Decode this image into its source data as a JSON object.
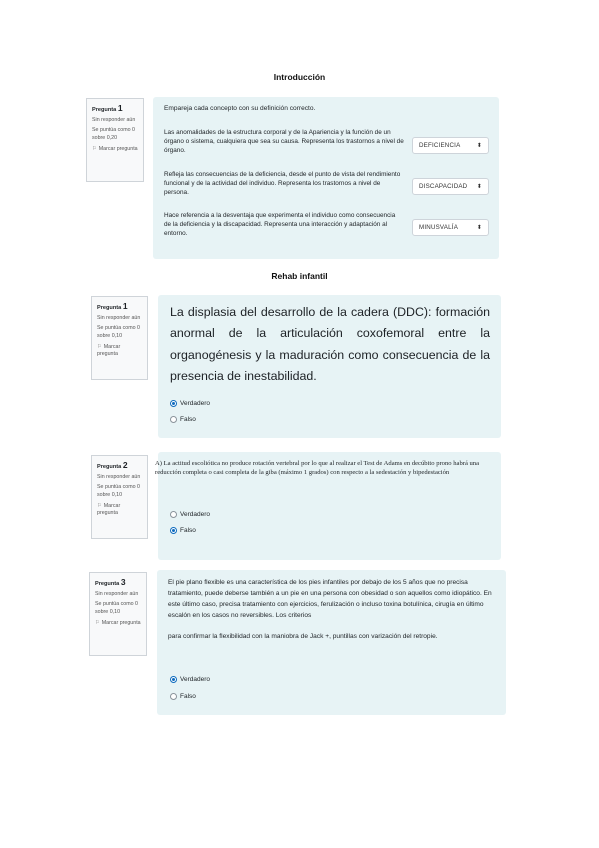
{
  "sections": {
    "intro": "Introducción",
    "rehab": "Rehab infantil"
  },
  "q1": {
    "label": "Pregunta",
    "num": "1",
    "status": "Sin responder aún",
    "score": "Se puntúa como 0 sobre 0,20",
    "flag": "Marcar pregunta",
    "prompt": "Empareja cada concepto con su definición correcto.",
    "rows": [
      {
        "text": "Las anomalidades de la estructura corporal y de la Apariencia y la función de un órgano o sistema, cualquiera que sea su causa. Representa los trastornos a nivel de órgano.",
        "selected": "DEFICIENCIA"
      },
      {
        "text": "Refleja las consecuencias de la deficiencia, desde el punto de vista del rendimiento funcional y de la actividad del individuo. Representa los trastornos a nivel de persona.",
        "selected": "DISCAPACIDAD"
      },
      {
        "text": "Hace referencia a la desventaja que experimenta el individuo como consecuencia de la deficiencia y la discapacidad. Representa una interacción y adaptación al entorno.",
        "selected": "MINUSVALÍA"
      }
    ]
  },
  "rq1": {
    "label": "Pregunta",
    "num": "1",
    "status": "Sin responder aún",
    "score": "Se puntúa como 0 sobre 0,10",
    "flag": "Marcar pregunta",
    "text": "La displasia del desarrollo de la cadera (DDC): formación anormal de la articulación coxofemoral entre la organogénesis y la maduración como consecuencia de la presencia de inestabilidad.",
    "options": [
      "Verdadero",
      "Falso"
    ],
    "selected": 0
  },
  "rq2": {
    "label": "Pregunta",
    "num": "2",
    "status": "Sin responder aún",
    "score": "Se puntúa como 0 sobre 0,10",
    "flag": "Marcar pregunta",
    "text": "A) La actitud escoliótica no produce rotación vertebral por lo que al realizar el Test de Adams en decúbito prono habrá una reducción completa o casi completa de la giba (máximo 1 grados) con respecto a la sedestación y bipedestación",
    "options": [
      "Verdadero",
      "Falso"
    ],
    "selected": 1
  },
  "rq3": {
    "label": "Pregunta",
    "num": "3",
    "status": "Sin responder aún",
    "score": "Se puntúa como 0 sobre 0,10",
    "flag": "Marcar pregunta",
    "text": "El pie plano flexible es una característica de los pies infantiles por debajo de los 5 años que no precisa tratamiento, puede deberse también a un pie en una persona con obesidad o son aquellos como idiopático. En este último caso, precisa tratamiento con ejercicios, ferulización o incluso toxina botulínica, cirugía en último escalón en los casos no reversibles. Los criterios",
    "extra": "para confirmar la flexibilidad con la maniobra de Jack +, puntillas con varización del retropie.",
    "options": [
      "Verdadero",
      "Falso"
    ],
    "selected": 0
  }
}
